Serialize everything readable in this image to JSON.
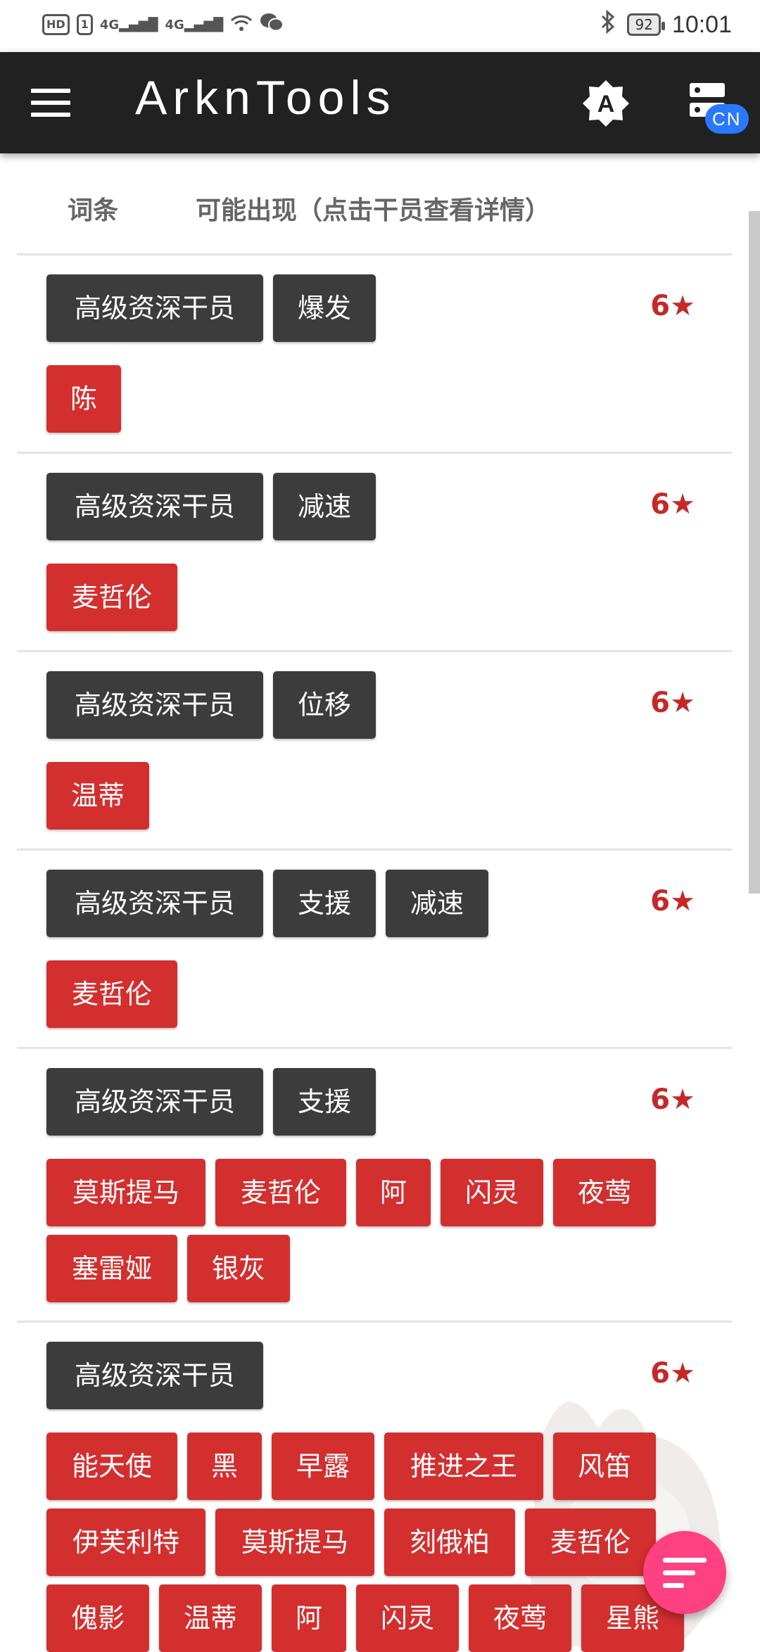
{
  "status_bar": {
    "hd": "HD",
    "sim": "1",
    "signal1": "4G",
    "signal2": "4G",
    "battery": "92",
    "time": "10:01"
  },
  "app_bar": {
    "title": "ArknTools",
    "theme_icon_letter": "A",
    "server_badge": "CN"
  },
  "table_header": {
    "tags_col": "词条",
    "operators_col": "可能出现（点击干员查看详情）"
  },
  "groups": [
    {
      "tags": [
        "高级资深干员",
        "爆发"
      ],
      "rarity": "6★",
      "operators": [
        "陈"
      ]
    },
    {
      "tags": [
        "高级资深干员",
        "减速"
      ],
      "rarity": "6★",
      "operators": [
        "麦哲伦"
      ]
    },
    {
      "tags": [
        "高级资深干员",
        "位移"
      ],
      "rarity": "6★",
      "operators": [
        "温蒂"
      ]
    },
    {
      "tags": [
        "高级资深干员",
        "支援",
        "减速"
      ],
      "rarity": "6★",
      "operators": [
        "麦哲伦"
      ]
    },
    {
      "tags": [
        "高级资深干员",
        "支援"
      ],
      "rarity": "6★",
      "operators": [
        "莫斯提马",
        "麦哲伦",
        "阿",
        "闪灵",
        "夜莺",
        "塞雷娅",
        "银灰"
      ]
    },
    {
      "tags": [
        "高级资深干员"
      ],
      "rarity": "6★",
      "operators": [
        "能天使",
        "黑",
        "早露",
        "推进之王",
        "风笛",
        "伊芙利特",
        "莫斯提马",
        "刻俄柏",
        "麦哲伦",
        "傀影",
        "温蒂",
        "阿",
        "闪灵",
        "夜莺",
        "星熊"
      ]
    }
  ],
  "colors": {
    "app_bar": "#212121",
    "tag_chip": "#3c3c3c",
    "operator_chip": "#d32f2f",
    "rarity_text": "#c62828",
    "fab": "#ff4081",
    "badge": "#2979ff"
  },
  "icons": [
    "menu-icon",
    "theme-icon",
    "server-icon",
    "sort-icon"
  ]
}
